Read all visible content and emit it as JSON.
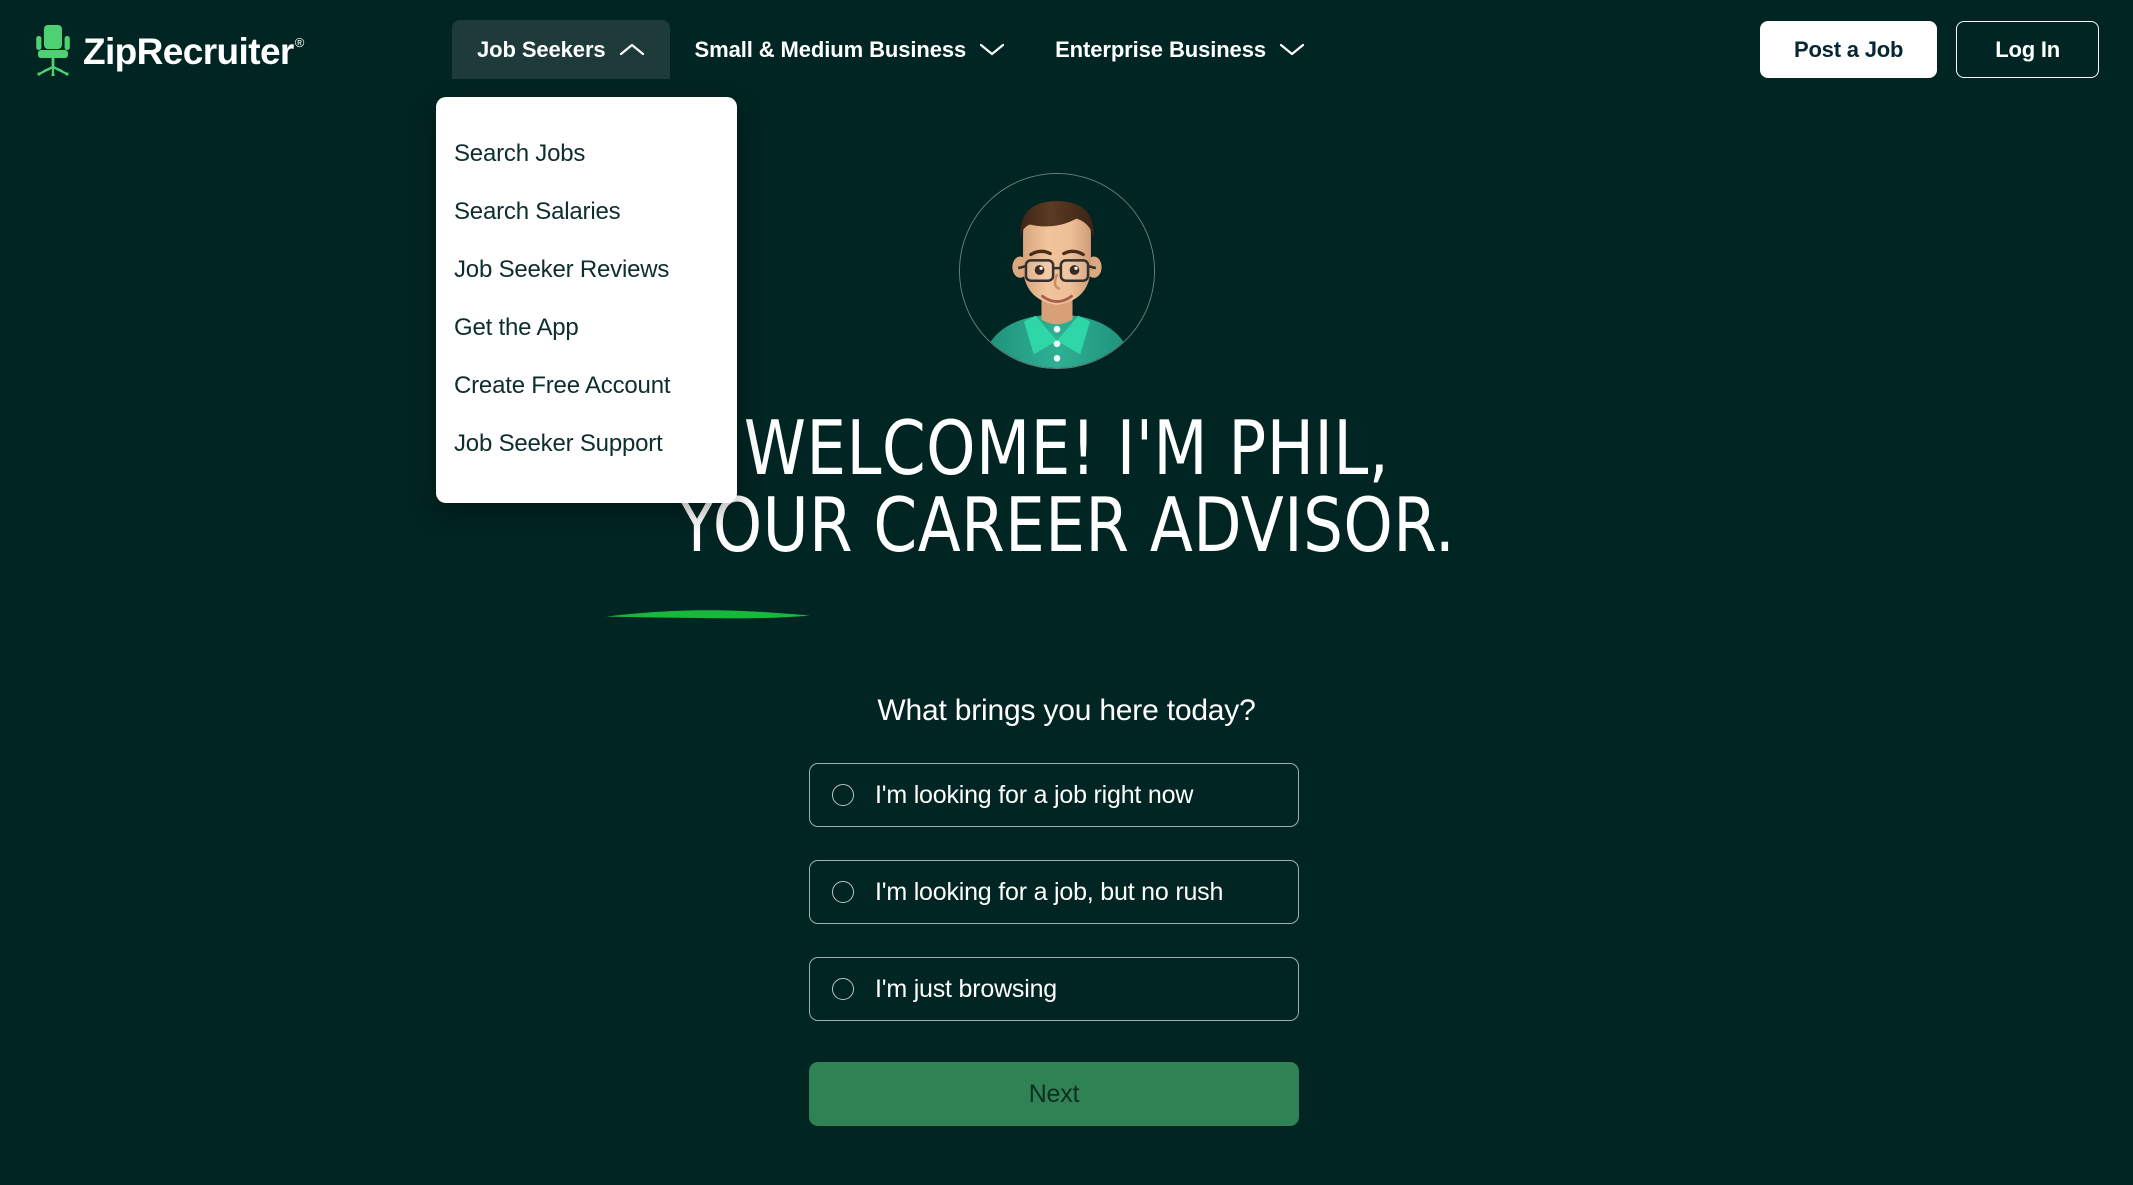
{
  "brand": {
    "name": "ZipRecruiter",
    "registered_mark": "®",
    "logo_icon": "office-chair-icon",
    "green": "#4ed173",
    "background": "#002522",
    "accent_green": "#2f8253"
  },
  "header": {
    "nav": [
      {
        "label": "Job Seekers",
        "chevron": "chevron-up-icon",
        "expanded": true
      },
      {
        "label": "Small & Medium Business",
        "chevron": "chevron-down-icon",
        "expanded": false
      },
      {
        "label": "Enterprise Business",
        "chevron": "chevron-down-icon",
        "expanded": false
      }
    ],
    "post_job_label": "Post a Job",
    "login_label": "Log In"
  },
  "dropdown": {
    "owner": "Job Seekers",
    "items": [
      {
        "label": "Search Jobs"
      },
      {
        "label": "Search Salaries"
      },
      {
        "label": "Job Seeker Reviews"
      },
      {
        "label": "Get the App"
      },
      {
        "label": "Create Free Account"
      },
      {
        "label": "Job Seeker Support"
      }
    ]
  },
  "hero": {
    "avatar_icon": "advisor-avatar",
    "headline_line1": "WELCOME! I'M PHIL,",
    "headline_line2": "YOUR CAREER ADVISOR.",
    "underline": "green-brushstroke"
  },
  "form": {
    "question": "What brings you here today?",
    "options": [
      {
        "label": "I'm looking for a job right now",
        "selected": false
      },
      {
        "label": "I'm looking for a job, but no rush",
        "selected": false
      },
      {
        "label": "I'm just browsing",
        "selected": false
      }
    ],
    "next_label": "Next"
  }
}
